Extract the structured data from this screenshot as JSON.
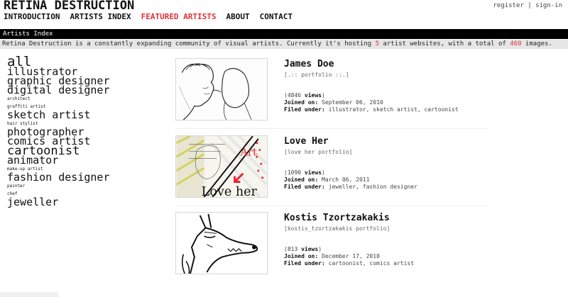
{
  "site": {
    "title": "RETINA DESTRUCTION"
  },
  "nav": {
    "items": [
      {
        "label": "INTRODUCTION"
      },
      {
        "label": "ARTISTS INDEX"
      },
      {
        "label": "FEATURED ARTISTS"
      },
      {
        "label": "ABOUT"
      },
      {
        "label": "CONTACT"
      }
    ]
  },
  "account": {
    "register": "register",
    "separator": "|",
    "sign_in": "sign-in"
  },
  "index_bar": {
    "label": "Artists Index"
  },
  "intro": {
    "part1": "Retina Destruction is a constantly expanding community of visual artists. Currently it's hosting ",
    "sites_count": "5",
    "part2": " artist websites, with a total of ",
    "images_count": "460",
    "part3": " images."
  },
  "tags": [
    "all",
    "illustrator",
    "graphic designer",
    "digital designer",
    "architect",
    "graffiti artist",
    "sketch artist",
    "hair stylist",
    "photographer",
    "comics artist",
    "cartoonist",
    "animator",
    "make-up artist",
    "fashion designer",
    "painter",
    "chef",
    "jeweller"
  ],
  "artists": [
    {
      "name": "James Doe",
      "subtitle": "[.:: portfolio ::.]",
      "views_count": "4846",
      "views_word": "views",
      "joined_label": "Joined on:",
      "joined_date": "September 06, 2010",
      "filed_label": "Filed under:",
      "filed_tags": "illustrator, sketch artist, cartoonist"
    },
    {
      "name": "Love Her",
      "subtitle": "[love her portfolio]",
      "views_count": "1090",
      "views_word": "views",
      "joined_label": "Joined on:",
      "joined_date": "March 06, 2011",
      "filed_label": "Filed under:",
      "filed_tags": "jeweller, fashion designer",
      "thumb_text_1": "Love her",
      "thumb_text_2": "Art"
    },
    {
      "name": "Kostis Tzortzakakis",
      "subtitle": "[kostis_tzortzakakis portfolio]",
      "views_count": "813",
      "views_word": "views",
      "joined_label": "Joined on:",
      "joined_date": "December 17, 2010",
      "filed_label": "Filed under:",
      "filed_tags": "cartoonist, comics artist"
    }
  ],
  "colors": {
    "accent": "#e0303a",
    "bar": "#000000",
    "intro_bg": "#e6e6e6"
  }
}
